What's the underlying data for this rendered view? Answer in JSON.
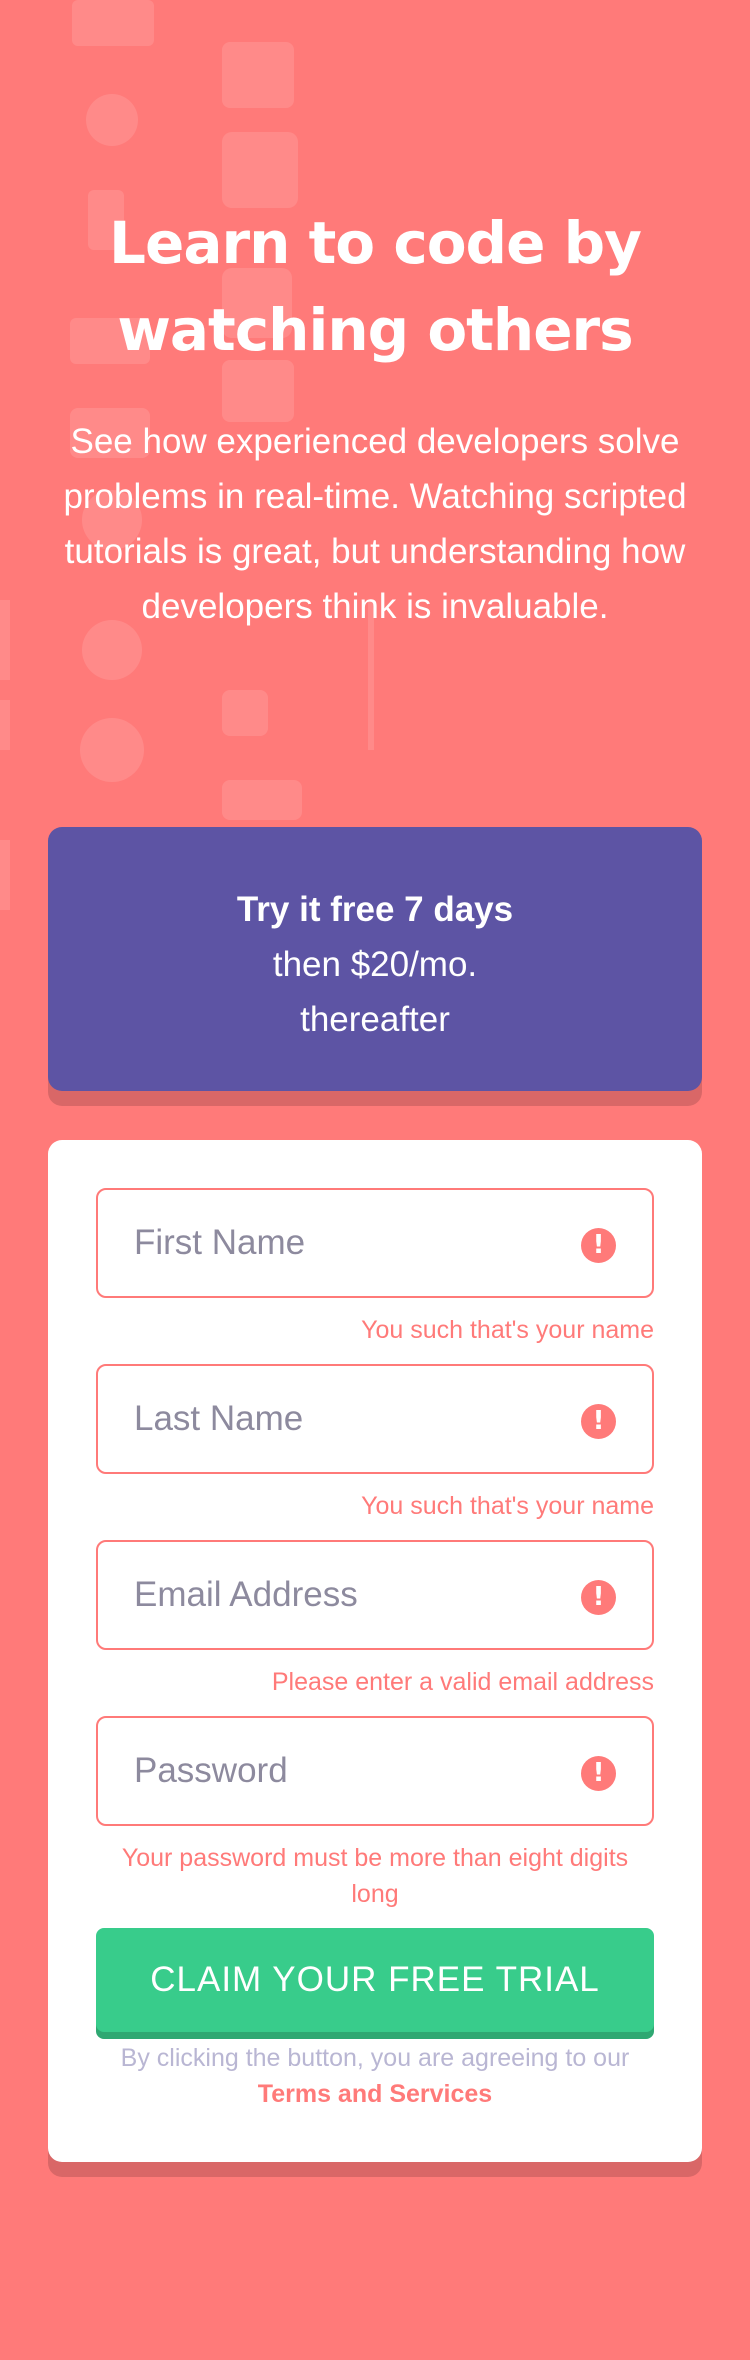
{
  "hero": {
    "title_line1": "Learn to code by",
    "title_line2": "watching others",
    "description": "See how experienced developers solve problems in real-time. Watching scripted tutorials is great, but understanding how developers think is invaluable."
  },
  "promo": {
    "bold": "Try it free 7 days",
    "line2": "then $20/mo.",
    "line3": "thereafter"
  },
  "form": {
    "fields": [
      {
        "placeholder": "First Name",
        "error": "You such that's your name"
      },
      {
        "placeholder": "Last Name",
        "error": "You such that's your name"
      },
      {
        "placeholder": "Email Address",
        "error": "Please enter a valid email address"
      },
      {
        "placeholder": "Password",
        "error": "Your password must be more than eight digits long"
      }
    ],
    "error_icon": "!",
    "submit_label": "CLAIM YOUR FREE TRIAL",
    "terms_text": "By clicking the button, you are agreeing to our",
    "terms_link": "Terms and Services"
  },
  "colors": {
    "background": "#ff7a79",
    "promo": "#5d54a4",
    "button": "#38cc8b",
    "error": "#ff7a79"
  }
}
